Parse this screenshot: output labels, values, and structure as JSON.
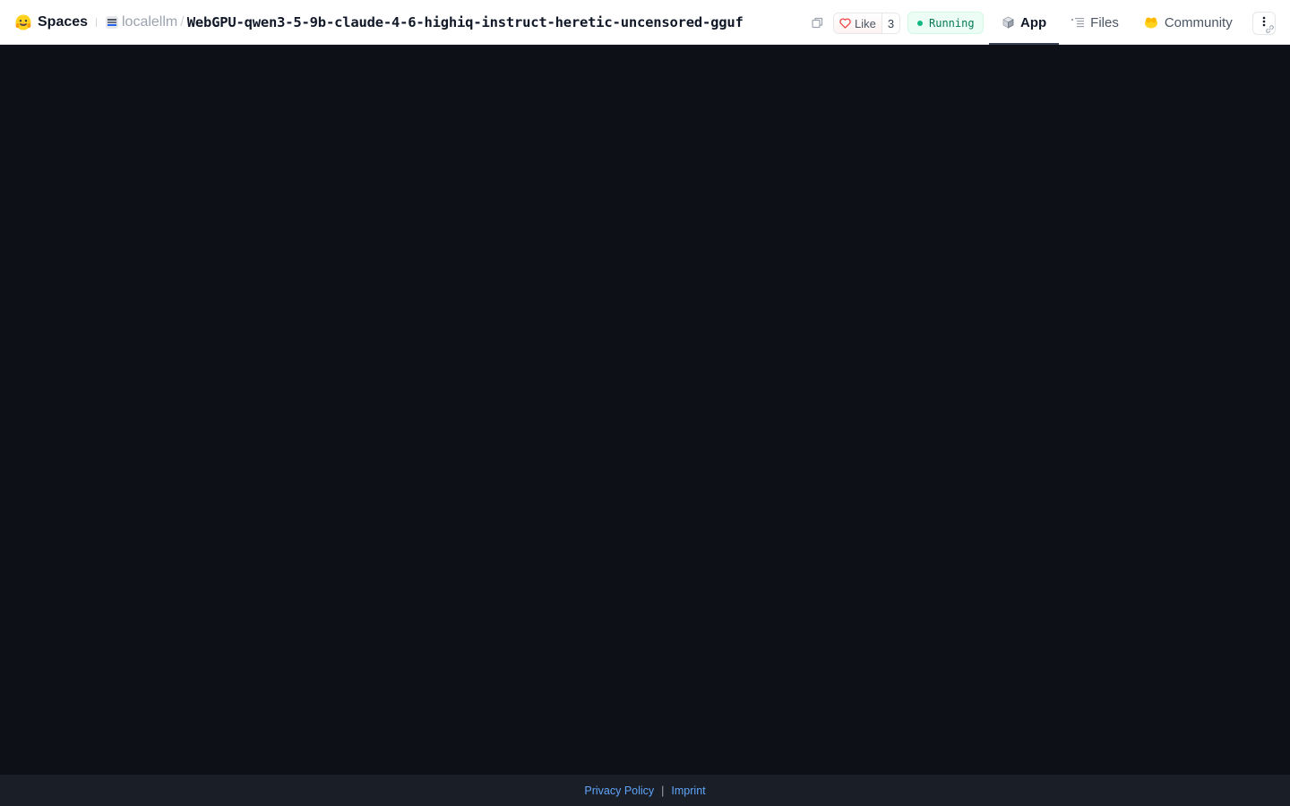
{
  "header": {
    "brand_label": "Spaces",
    "org_name": "localellm",
    "separator": "/",
    "repo_name": "WebGPU-qwen3-5-9b-claude-4-6-highiq-instruct-heretic-uncensored-gguf",
    "like_label": "Like",
    "like_count": "3",
    "status_label": "Running",
    "colors": {
      "status_bg": "#ecfdf5",
      "status_text": "#047857",
      "status_dot": "#10b981",
      "app_background": "#0d1017",
      "footer_background": "#1a1e27",
      "link_color": "#60a5fa"
    }
  },
  "tabs": [
    {
      "label": "App",
      "icon": "cube-icon",
      "active": true
    },
    {
      "label": "Files",
      "icon": "files-icon",
      "active": false
    },
    {
      "label": "Community",
      "icon": "community-icon",
      "active": false
    }
  ],
  "icons": {
    "brand": "hugging-face-icon",
    "org": "org-avatar-icon",
    "copy": "copy-icon",
    "like": "heart-icon",
    "more": "more-vertical-icon",
    "link": "link-icon"
  },
  "footer": {
    "privacy_label": "Privacy Policy",
    "separator": "|",
    "imprint_label": "Imprint"
  }
}
